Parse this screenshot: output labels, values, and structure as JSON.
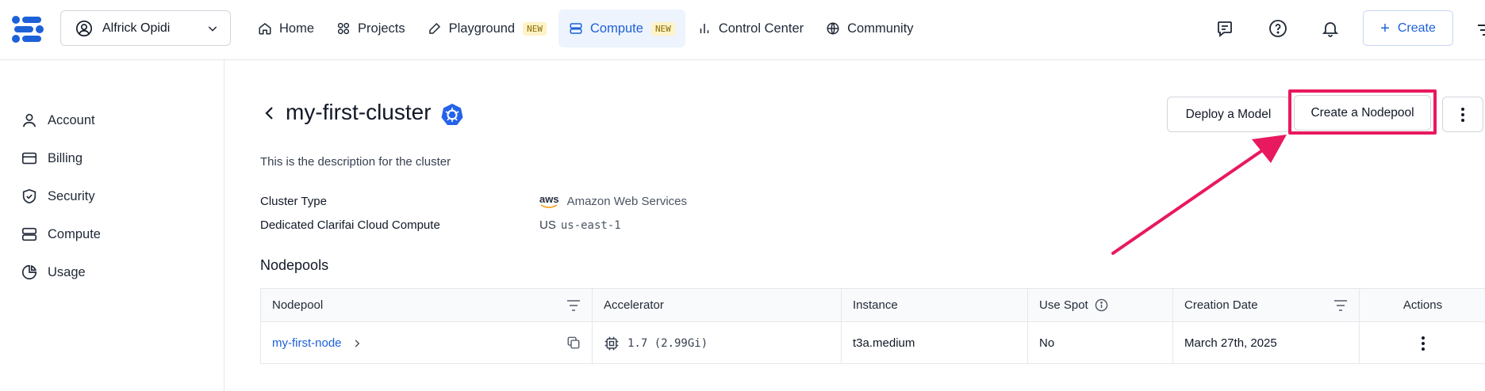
{
  "header": {
    "user_name": "Alfrick Opidi",
    "nav": [
      {
        "label": "Home",
        "icon": "home-icon"
      },
      {
        "label": "Projects",
        "icon": "grid-icon"
      },
      {
        "label": "Playground",
        "icon": "pen-icon",
        "badge": "NEW"
      },
      {
        "label": "Compute",
        "icon": "server-icon",
        "badge": "NEW",
        "active": true
      },
      {
        "label": "Control Center",
        "icon": "bar-chart-icon"
      },
      {
        "label": "Community",
        "icon": "globe-icon"
      }
    ],
    "create_label": "Create"
  },
  "sidebar": {
    "items": [
      {
        "label": "Account",
        "icon": "user-icon"
      },
      {
        "label": "Billing",
        "icon": "credit-card-icon"
      },
      {
        "label": "Security",
        "icon": "shield-icon"
      },
      {
        "label": "Compute",
        "icon": "server-icon"
      },
      {
        "label": "Usage",
        "icon": "pie-chart-icon"
      }
    ]
  },
  "cluster": {
    "name": "my-first-cluster",
    "description": "This is the description for the cluster",
    "details": [
      {
        "key": "Cluster Type",
        "prefix": "aws",
        "value": "Amazon Web Services"
      },
      {
        "key": "Dedicated Clarifai Cloud Compute",
        "prefix": "US",
        "value": "us-east-1"
      }
    ],
    "actions": {
      "deploy_label": "Deploy a Model",
      "create_nodepool_label": "Create a Nodepool"
    }
  },
  "nodepools": {
    "title": "Nodepools",
    "columns": [
      "Nodepool",
      "Accelerator",
      "Instance",
      "Use Spot",
      "Creation Date",
      "Actions"
    ],
    "rows": [
      {
        "nodepool": "my-first-node",
        "accelerator": "1.7 (2.99Gi)",
        "instance": "t3a.medium",
        "use_spot": "No",
        "creation_date": "March 27th, 2025"
      }
    ]
  },
  "colors": {
    "accent": "#1d61d8",
    "highlight": "#e8195f",
    "new_badge_bg": "#fdf3c7"
  }
}
